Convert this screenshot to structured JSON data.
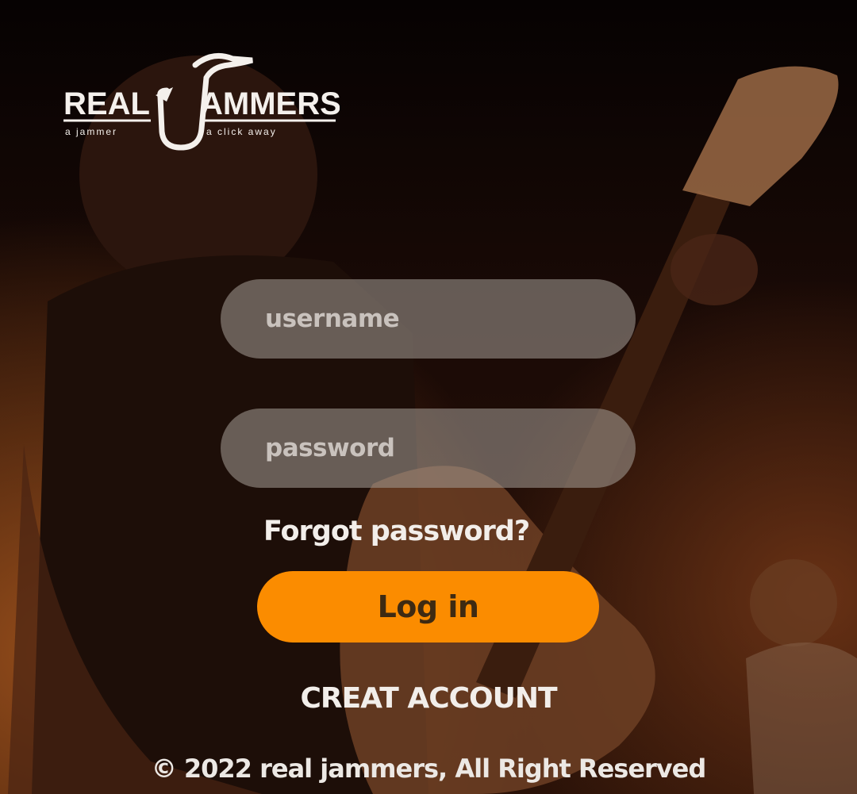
{
  "logo": {
    "left_text": "REAL",
    "right_text": "AMMERS",
    "tagline_left": "a  jammer",
    "tagline_right": "a  click  away"
  },
  "form": {
    "username_placeholder": "username",
    "password_placeholder": "password",
    "forgot_label": "Forgot password?",
    "login_label": "Log in",
    "create_label": "CREAT ACCOUNT"
  },
  "footer": {
    "copyright": "© 2022 real jammers, All Right Reserved"
  },
  "colors": {
    "accent": "#fb8c00",
    "field_bg": "#a59e98",
    "text": "#f2eeea"
  },
  "icons": [
    "saxophone-logo-icon"
  ]
}
